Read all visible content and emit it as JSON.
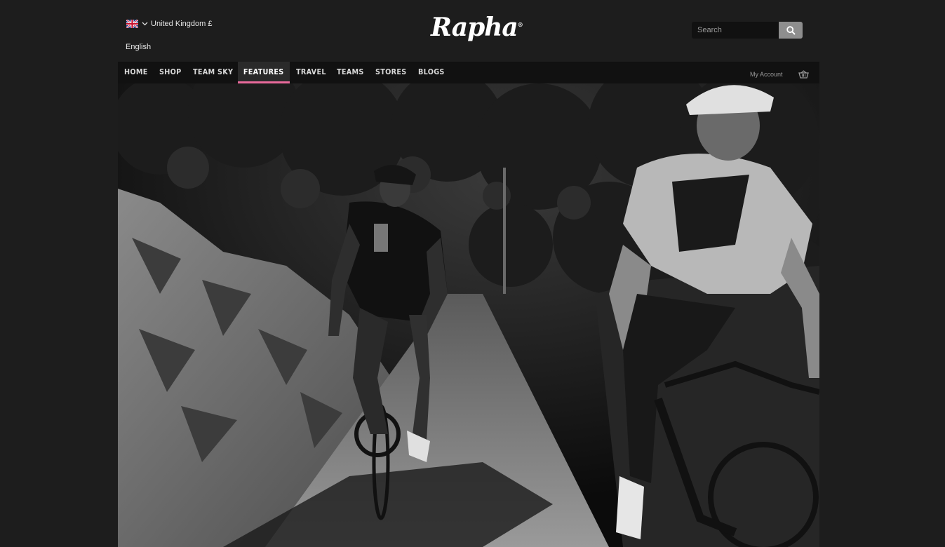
{
  "header": {
    "region": "United Kingdom £",
    "language": "English",
    "logo": "Rapha",
    "search": {
      "placeholder": "Search"
    }
  },
  "nav": {
    "items": [
      {
        "label": "HOME"
      },
      {
        "label": "SHOP"
      },
      {
        "label": "TEAM SKY"
      },
      {
        "label": "FEATURES",
        "active": true
      },
      {
        "label": "TRAVEL"
      },
      {
        "label": "TEAMS"
      },
      {
        "label": "STORES"
      },
      {
        "label": "BLOGS"
      }
    ],
    "account_label": "My Account"
  },
  "colors": {
    "accent": "#e8699b",
    "background": "#1d1d1d",
    "nav_bg": "#111111"
  }
}
